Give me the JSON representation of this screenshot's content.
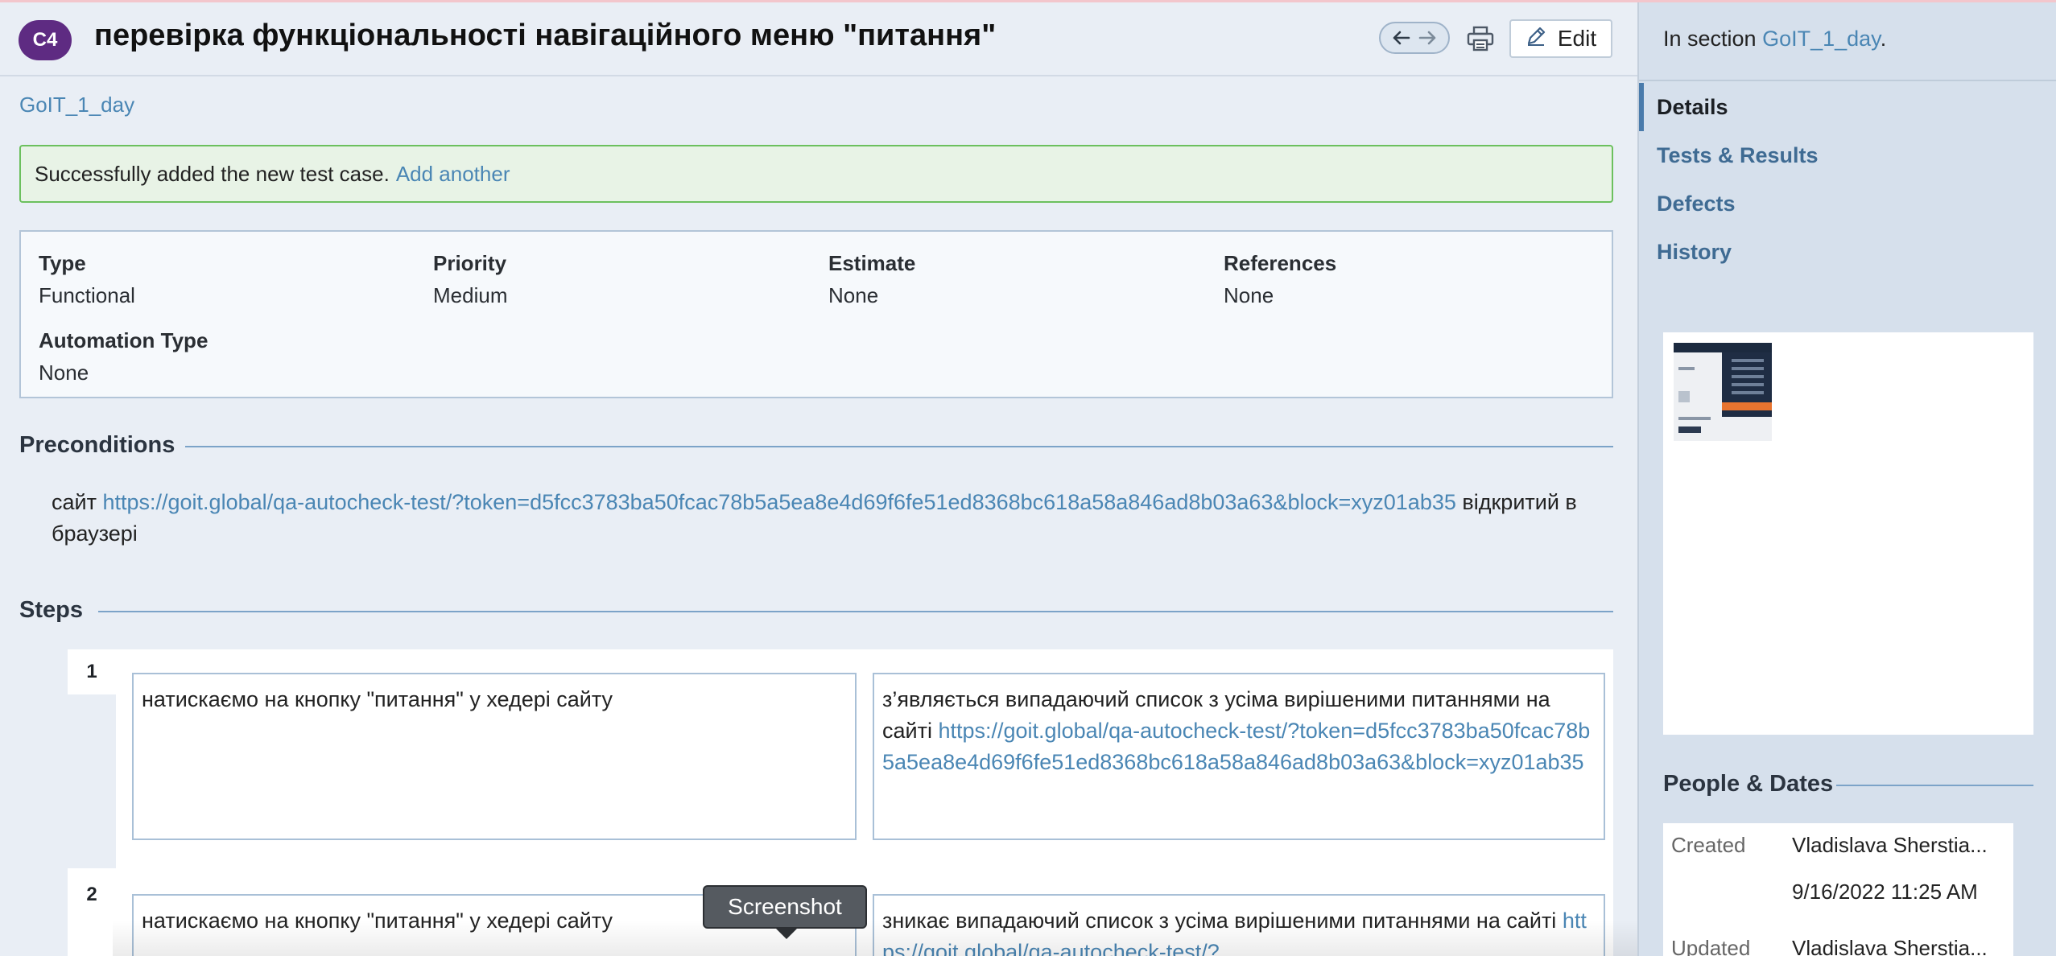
{
  "header": {
    "case_id": "C4",
    "title": "перевірка функціональності навігаційного меню \"питання\"",
    "edit_label": "Edit"
  },
  "breadcrumb": "GoIT_1_day",
  "success": {
    "message": "Successfully added the new test case.",
    "link": "Add another"
  },
  "fields": {
    "type": {
      "label": "Type",
      "value": "Functional"
    },
    "priority": {
      "label": "Priority",
      "value": "Medium"
    },
    "estimate": {
      "label": "Estimate",
      "value": "None"
    },
    "references": {
      "label": "References",
      "value": "None"
    },
    "automation": {
      "label": "Automation Type",
      "value": "None"
    }
  },
  "preconditions": {
    "heading": "Preconditions",
    "prefix": "сайт",
    "url": "https://goit.global/qa-autocheck-test/?token=d5fcc3783ba50fcac78b5a5ea8e4d69f6fe51ed8368bc618a58a846ad8b03a63&block=xyz01ab35",
    "suffix": "відкритий в браузері"
  },
  "steps": {
    "heading": "Steps",
    "items": [
      {
        "number": "1",
        "content": "натискаємо на кнопку \"питання\" у хедері сайту",
        "expected_text": "з’являється випадаючий список з усіма вирішеними питаннями на сайті",
        "expected_url": "https://goit.global/qa-autocheck-test/?token=d5fcc3783ba50fcac78b5a5ea8e4d69f6fe51ed8368bc618a58a846ad8b03a63&block=xyz01ab35"
      },
      {
        "number": "2",
        "content": "натискаємо на кнопку \"питання\" у хедері сайту",
        "expected_text": "зникає випадаючий список з усіма вирішеними питаннями на сайті",
        "expected_url": "https://goit.global/qa-autocheck-test/?"
      }
    ]
  },
  "tooltip": "Screenshot",
  "sidebar": {
    "in_section_prefix": "In section",
    "in_section_link": "GoIT_1_day",
    "in_section_suffix": ".",
    "nav": [
      "Details",
      "Tests & Results",
      "Defects",
      "History"
    ],
    "people_heading": "People & Dates",
    "created_label": "Created",
    "created_by": "Vladislava Sherstia...",
    "created_date": "9/16/2022 11:25 AM",
    "updated_label": "Updated",
    "updated_by": "Vladislava Sherstia..."
  }
}
